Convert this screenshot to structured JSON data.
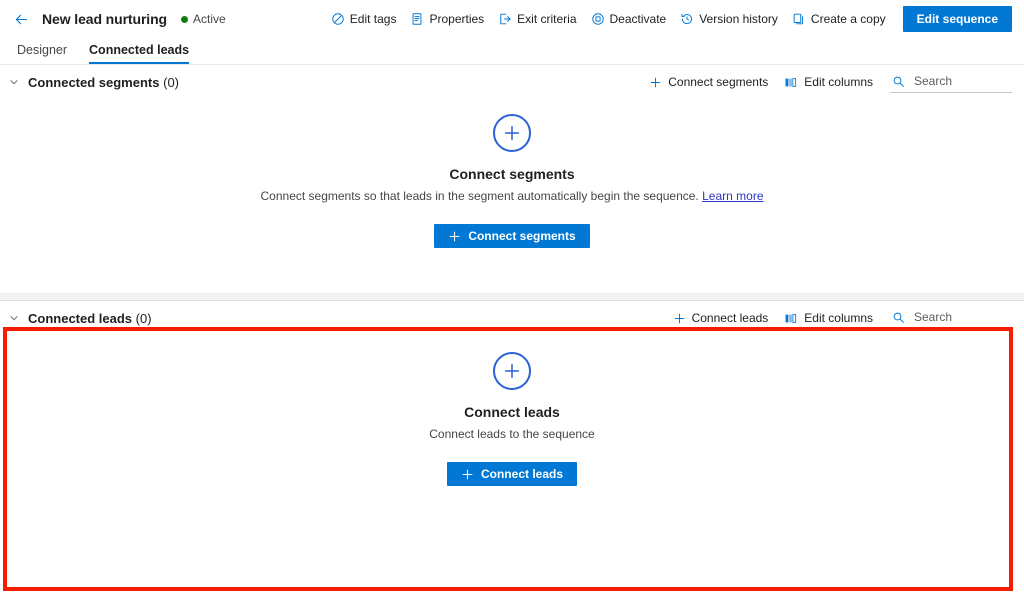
{
  "header": {
    "back_icon": "arrow-left-icon",
    "title": "New lead nurturing",
    "status_label": "Active",
    "status_color": "#107c10",
    "commands": [
      {
        "label": "Edit tags",
        "icon": "tag-icon"
      },
      {
        "label": "Properties",
        "icon": "properties-document-icon"
      },
      {
        "label": "Exit criteria",
        "icon": "exit-arrow-icon"
      },
      {
        "label": "Deactivate",
        "icon": "deactivate-circle-icon"
      },
      {
        "label": "Version history",
        "icon": "history-clock-icon"
      },
      {
        "label": "Create a copy",
        "icon": "copy-icon"
      }
    ],
    "primary_button": {
      "label": "Edit sequence",
      "color": "#0078d4"
    }
  },
  "tabs": [
    {
      "label": "Designer",
      "active": false
    },
    {
      "label": "Connected leads",
      "active": true
    }
  ],
  "sections": [
    {
      "id": "connected-segments",
      "chevron_icon": "chevron-down-icon",
      "title": "Connected segments",
      "count": "(0)",
      "tools": [
        {
          "label": "Connect segments",
          "icon": "plus-icon"
        },
        {
          "label": "Edit columns",
          "icon": "edit-columns-icon"
        }
      ],
      "search": {
        "placeholder": "Search",
        "value": "",
        "icon": "search-icon"
      },
      "empty_state": {
        "icon": "plus-circle-icon",
        "title": "Connect segments",
        "description": "Connect segments so that leads in the segment automatically begin the sequence.",
        "link_label": "Learn more",
        "button_label": "Connect segments",
        "button_icon": "plus-icon"
      }
    },
    {
      "id": "connected-leads",
      "chevron_icon": "chevron-down-icon",
      "title": "Connected leads",
      "count": "(0)",
      "tools": [
        {
          "label": "Connect leads",
          "icon": "plus-icon"
        },
        {
          "label": "Edit columns",
          "icon": "edit-columns-icon"
        }
      ],
      "search": {
        "placeholder": "Search",
        "value": "",
        "icon": "search-icon"
      },
      "empty_state": {
        "icon": "plus-circle-icon",
        "title": "Connect leads",
        "description": "Connect leads to the sequence",
        "link_label": "",
        "button_label": "Connect leads",
        "button_icon": "plus-icon"
      }
    }
  ],
  "annotation": {
    "highlight_color": "#f71b00",
    "target_section": "connected-leads"
  }
}
